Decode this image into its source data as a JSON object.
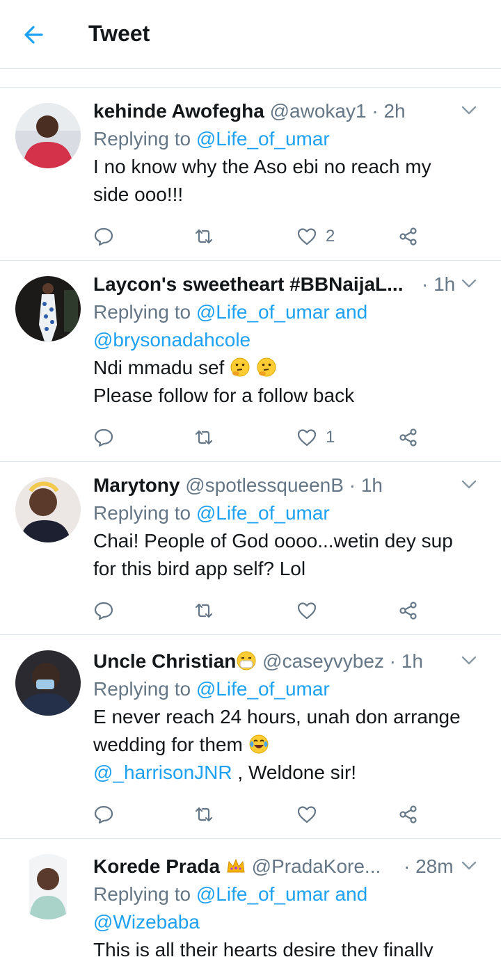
{
  "header": {
    "title": "Tweet"
  },
  "tweets": [
    {
      "name": "kehinde Awofegha",
      "handle": "@awokay1",
      "sep": "·",
      "time": "2h",
      "replying_prefix": "Replying to",
      "replying_to": "@Life_of_umar",
      "replying_and": "",
      "replying_to2": "",
      "lines": [
        "I no know why the Aso ebi no reach my",
        "side ooo!!!"
      ],
      "likes": "2"
    },
    {
      "name": "Laycon's sweetheart #BBNaijaL...",
      "handle": "",
      "sep": "·",
      "time": "1h",
      "replying_prefix": "Replying to",
      "replying_to": "@Life_of_umar",
      "replying_and": "and",
      "replying_to2": "@brysonadahcole",
      "lines": [
        "Ndi mmadu sef",
        "Please follow for a follow back"
      ],
      "likes": "1"
    },
    {
      "name": "Marytony",
      "handle": "@spotlessqueenB",
      "sep": "·",
      "time": "1h",
      "replying_prefix": "Replying to",
      "replying_to": "@Life_of_umar",
      "lines": [
        "Chai! People of God oooo...wetin dey sup",
        "for this bird app self? Lol"
      ],
      "likes": ""
    },
    {
      "name": "Uncle Christian",
      "handle": "@caseyvybez",
      "sep": "·",
      "time": "1h",
      "replying_prefix": "Replying to",
      "replying_to": "@Life_of_umar",
      "lines": [
        "E never reach 24 hours, unah don arrange",
        "wedding for them"
      ],
      "mention": "@_harrisonJNR",
      "mention_after": " , Weldone sir!",
      "likes": ""
    },
    {
      "name": "Korede Prada",
      "handle": "@PradaKore...",
      "sep": "·",
      "time": "28m",
      "replying_prefix": "Replying to",
      "replying_to": "@Life_of_umar",
      "replying_and": "and",
      "replying_to2": "@Wizebaba",
      "lines": [
        "This is all their hearts desire they finally"
      ],
      "likes": ""
    }
  ],
  "icons": {
    "back": "arrow-left-icon",
    "chevron": "chevron-down-icon",
    "reply": "comment-icon",
    "retweet": "retweet-icon",
    "like": "heart-icon",
    "share": "share-icon"
  },
  "colors": {
    "accent": "#1da1f2",
    "secondary": "#657786",
    "text": "#14171a",
    "divider": "#e1e8ed"
  }
}
